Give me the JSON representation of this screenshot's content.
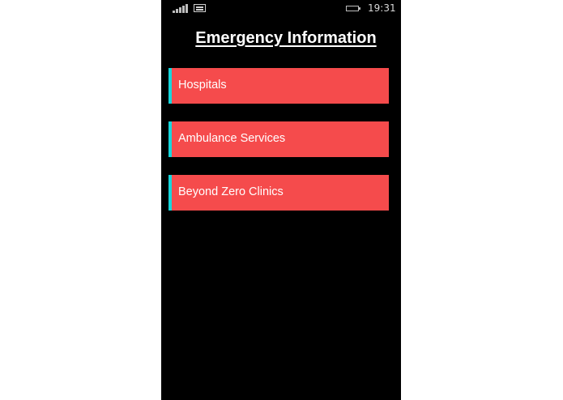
{
  "statusbar": {
    "signal_icon": "signal-strength-icon",
    "message_icon": "message-icon",
    "battery_icon": "battery-icon",
    "time": "19:31"
  },
  "page": {
    "title": "Emergency Information"
  },
  "menu": {
    "items": [
      {
        "label": "Hospitals"
      },
      {
        "label": "Ambulance Services"
      },
      {
        "label": "Beyond Zero Clinics"
      }
    ]
  },
  "colors": {
    "background": "#000000",
    "item_background": "#f54b4c",
    "item_accent": "#17d7dc",
    "text": "#ffffff"
  }
}
